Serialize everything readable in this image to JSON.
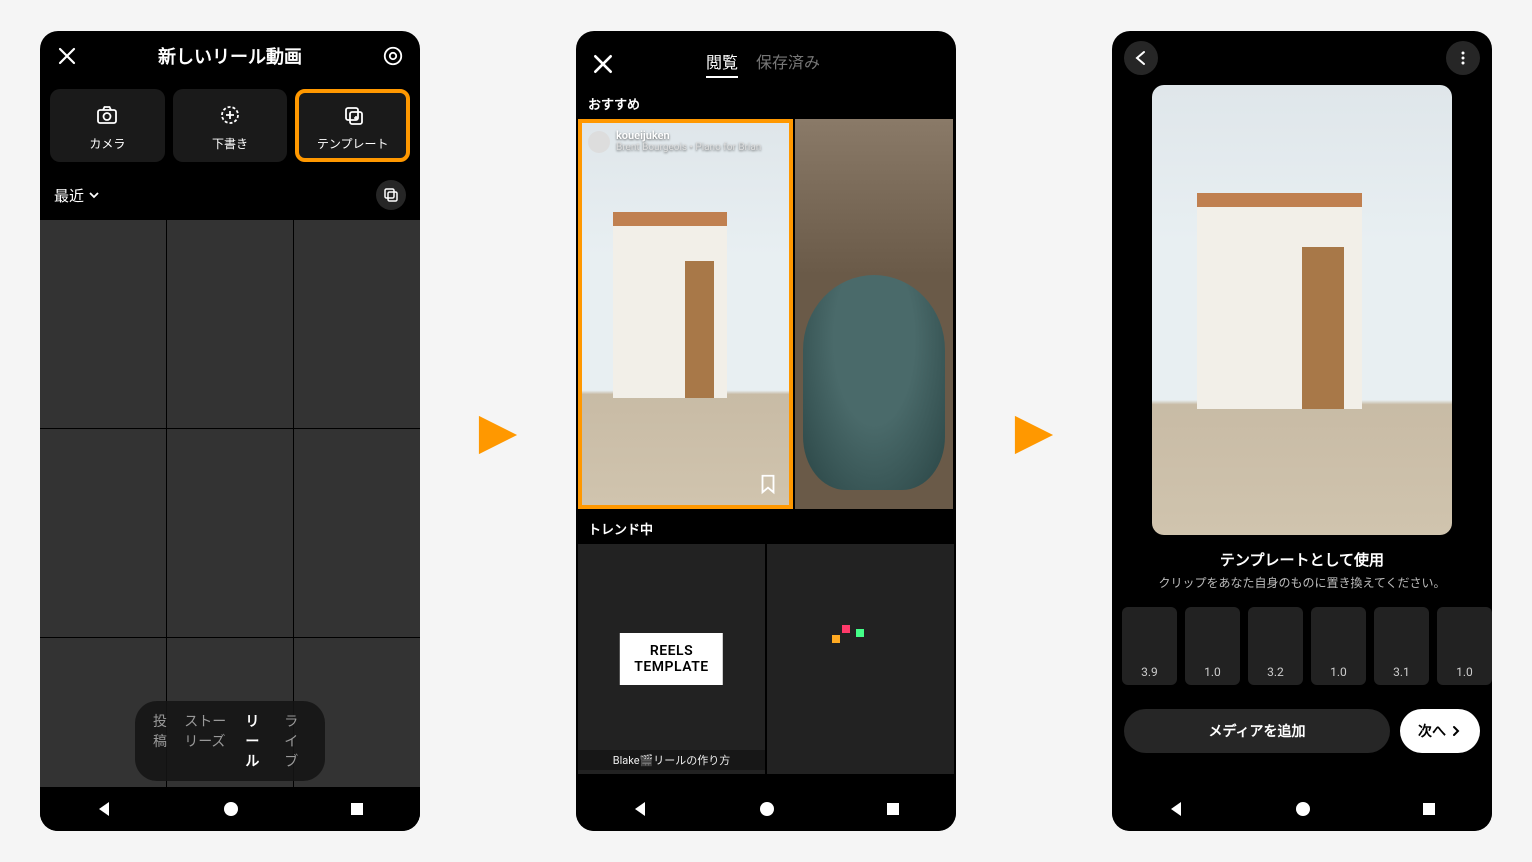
{
  "screen1": {
    "title": "新しいリール動画",
    "modes": {
      "camera": "カメラ",
      "draft": "下書き",
      "template": "テンプレート"
    },
    "recent": "最近",
    "tabs": {
      "post": "投稿",
      "stories": "ストーリーズ",
      "reels": "リール",
      "live": "ライブ"
    }
  },
  "screen2": {
    "tabs": {
      "browse": "閲覧",
      "saved": "保存済み"
    },
    "section_recommended": "おすすめ",
    "section_trending": "トレンド中",
    "template1": {
      "user": "koueijuken",
      "music": "Brent Bourgeois • Piano for Brian"
    },
    "trending": {
      "label_line1": "REELS",
      "label_line2": "TEMPLATE",
      "caption": "Blake🎬リールの作り方"
    }
  },
  "screen3": {
    "title": "テンプレートとして使用",
    "subtitle": "クリップをあなた自身のものに置き換えてください。",
    "clips": [
      "3.9",
      "1.0",
      "3.2",
      "1.0",
      "3.1",
      "1.0"
    ],
    "add_media": "メディアを追加",
    "next": "次へ"
  }
}
